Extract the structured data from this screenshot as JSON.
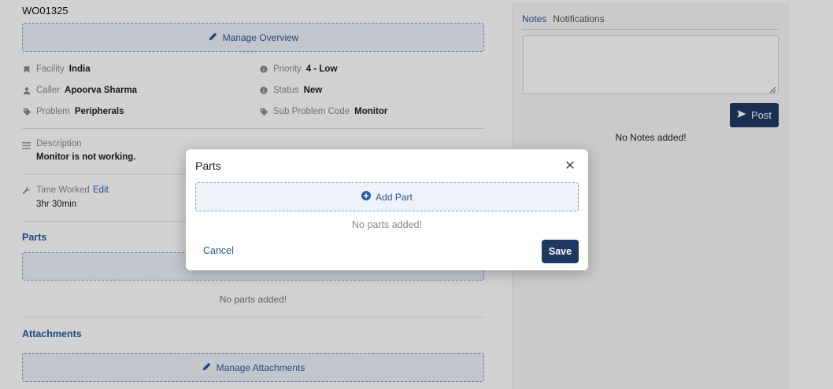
{
  "work_order": {
    "id": "WO01325",
    "manage_overview_label": "Manage Overview",
    "fields": {
      "facility": {
        "label": "Facility",
        "value": "India"
      },
      "priority": {
        "label": "Priority",
        "value": "4 - Low"
      },
      "caller": {
        "label": "Caller",
        "value": "Apoorva Sharma"
      },
      "status": {
        "label": "Status",
        "value": "New"
      },
      "problem": {
        "label": "Problem",
        "value": "Peripherals"
      },
      "sub_problem": {
        "label": "Sub Problem Code",
        "value": "Monitor"
      }
    },
    "description": {
      "label": "Description",
      "value": "Monitor is not working."
    },
    "time_worked": {
      "label": "Time Worked",
      "edit_label": "Edit",
      "value": "3hr 30min"
    },
    "parts": {
      "title": "Parts",
      "empty": "No parts added!"
    },
    "attachments": {
      "title": "Attachments",
      "manage_label": "Manage Attachments"
    }
  },
  "side_panel": {
    "tabs": [
      {
        "label": "Notes",
        "active": true
      },
      {
        "label": "Notifications",
        "active": false
      }
    ],
    "post_label": "Post",
    "empty": "No Notes added!"
  },
  "modal": {
    "title": "Parts",
    "add_part_label": "Add Part",
    "empty": "No parts added!",
    "cancel_label": "Cancel",
    "save_label": "Save"
  },
  "colors": {
    "accent": "#2b5a9c",
    "primary_button": "#1e3a63",
    "muted_text": "#8a8a8a"
  }
}
